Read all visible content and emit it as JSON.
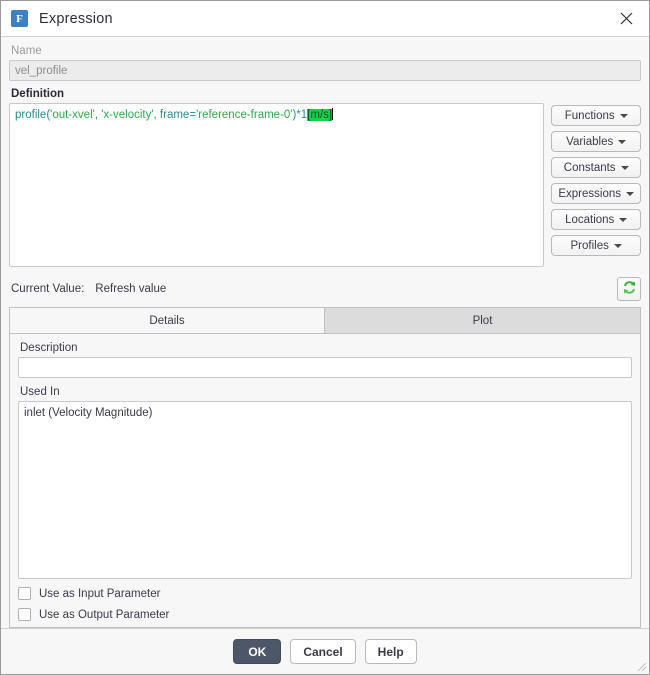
{
  "window": {
    "title": "Expression",
    "app_icon": "fluent-app-icon",
    "app_icon_letter": "F",
    "close_icon": "close-icon",
    "accent_color": "#3b82c4",
    "primary_button_color": "#4e5769",
    "selection_color": "#16d34a"
  },
  "name_field": {
    "label": "Name",
    "value": "vel_profile",
    "placeholder": "",
    "disabled": true
  },
  "definition": {
    "label": "Definition",
    "full_text": "profile('out-xvel', 'x-velocity', frame='reference-frame-0')*1[m/s]",
    "tokens": [
      {
        "text": "profile(",
        "kind": "code"
      },
      {
        "text": "'out-xvel'",
        "kind": "string"
      },
      {
        "text": ", ",
        "kind": "code"
      },
      {
        "text": "'x-velocity'",
        "kind": "string"
      },
      {
        "text": ", frame=",
        "kind": "code"
      },
      {
        "text": "'reference-frame-0'",
        "kind": "string"
      },
      {
        "text": ")*1",
        "kind": "code"
      },
      {
        "text": "[m/s]",
        "kind": "selected"
      }
    ],
    "buttons": [
      {
        "label": "Functions",
        "icon": "chevron-down-icon"
      },
      {
        "label": "Variables",
        "icon": "chevron-down-icon"
      },
      {
        "label": "Constants",
        "icon": "chevron-down-icon"
      },
      {
        "label": "Expressions",
        "icon": "chevron-down-icon"
      },
      {
        "label": "Locations",
        "icon": "chevron-down-icon"
      },
      {
        "label": "Profiles",
        "icon": "chevron-down-icon"
      }
    ]
  },
  "current_value": {
    "label": "Current Value:",
    "value": "Refresh value",
    "refresh_icon": "refresh-icon"
  },
  "tabs": [
    {
      "label": "Details",
      "active": true
    },
    {
      "label": "Plot",
      "active": false
    }
  ],
  "details": {
    "description": {
      "label": "Description",
      "value": "",
      "placeholder": ""
    },
    "used_in": {
      "label": "Used In",
      "items": [
        "inlet (Velocity Magnitude)"
      ]
    },
    "checkboxes": [
      {
        "label": "Use as Input Parameter",
        "checked": false
      },
      {
        "label": "Use as Output Parameter",
        "checked": false
      }
    ]
  },
  "footer": {
    "ok_label": "OK",
    "cancel_label": "Cancel",
    "help_label": "Help",
    "resize_grip": "resize-grip-icon"
  }
}
